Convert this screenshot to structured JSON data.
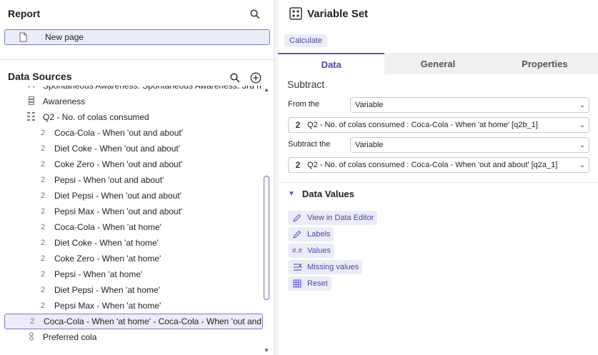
{
  "report": {
    "title": "Report",
    "new_page_label": "New page"
  },
  "data_sources": {
    "title": "Data Sources",
    "items": [
      {
        "label": "Spontaneous Awareness: Spontaneous Awareness: 3rd n",
        "icon": "text-icon",
        "indent": 1
      },
      {
        "label": "Awareness",
        "icon": "grid-icon",
        "indent": 1
      },
      {
        "label": "Q2 - No. of colas consumed",
        "icon": "number-grid-icon",
        "indent": 1
      },
      {
        "label": "Coca-Cola - When 'out and about'",
        "icon": "2",
        "indent": 2
      },
      {
        "label": "Diet Coke - When 'out and about'",
        "icon": "2",
        "indent": 2
      },
      {
        "label": "Coke Zero - When 'out and about'",
        "icon": "2",
        "indent": 2
      },
      {
        "label": "Pepsi - When 'out and about'",
        "icon": "2",
        "indent": 2
      },
      {
        "label": "Diet Pepsi - When 'out and about'",
        "icon": "2",
        "indent": 2
      },
      {
        "label": "Pepsi Max - When 'out and about'",
        "icon": "2",
        "indent": 2
      },
      {
        "label": "Coca-Cola - When 'at home'",
        "icon": "2",
        "indent": 2
      },
      {
        "label": "Diet Coke - When 'at home'",
        "icon": "2",
        "indent": 2
      },
      {
        "label": "Coke Zero - When 'at home'",
        "icon": "2",
        "indent": 2
      },
      {
        "label": "Pepsi - When 'at home'",
        "icon": "2",
        "indent": 2
      },
      {
        "label": "Diet Pepsi - When 'at home'",
        "icon": "2",
        "indent": 2
      },
      {
        "label": "Pepsi Max - When 'at home'",
        "icon": "2",
        "indent": 2
      },
      {
        "label": "Coca-Cola - When 'at home' - Coca-Cola - When 'out and",
        "icon": "2",
        "indent": 1,
        "selected": true
      },
      {
        "label": "Preferred cola",
        "icon": "nominal-icon",
        "indent": 1
      }
    ]
  },
  "panel": {
    "title": "Variable Set",
    "calculate_label": "Calculate",
    "tabs": [
      "Data",
      "General",
      "Properties"
    ],
    "active_tab": "Data",
    "subtract_title": "Subtract",
    "from_label": "From the",
    "from_type": "Variable",
    "from_value": "Q2 - No. of colas consumed : Coca-Cola - When 'at home' [q2b_1]",
    "subtract_label": "Subtract the",
    "subtract_type": "Variable",
    "subtract_value": "Q2 - No. of colas consumed : Coca-Cola - When 'out and about' [q2a_1]",
    "value_type_glyph": "2"
  },
  "data_values": {
    "title": "Data Values",
    "actions": [
      {
        "label": "View in Data Editor",
        "icon": "pencil-icon"
      },
      {
        "label": "Labels",
        "icon": "pencil-icon"
      },
      {
        "label": "Values",
        "icon": "hash-icon"
      },
      {
        "label": "Missing values",
        "icon": "missing-values-icon"
      },
      {
        "label": "Reset",
        "icon": "reset-table-icon"
      }
    ]
  },
  "colors": {
    "accent": "#5b58c0",
    "selection_bg": "#ececf8",
    "selection_border": "#7b79c9"
  }
}
